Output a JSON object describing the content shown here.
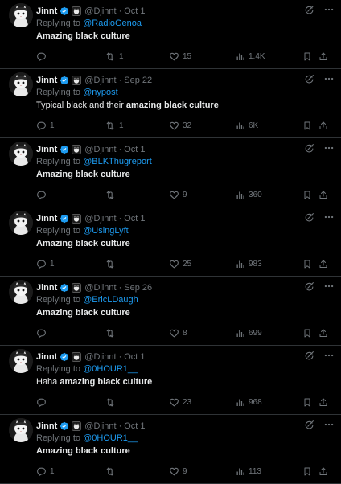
{
  "colors": {
    "background": "#000000",
    "text": "#e7e9ea",
    "muted": "#71767b",
    "link": "#1d9bf0",
    "divider": "#2f3336",
    "verified": "#1d9bf0"
  },
  "icons": {
    "verified": "verified-badge-icon",
    "affiliate": "affiliate-badge-icon",
    "grok": "grok-icon",
    "more": "more-icon",
    "reply": "reply-icon",
    "retweet": "retweet-icon",
    "like": "like-icon",
    "views": "views-icon",
    "bookmark": "bookmark-icon",
    "share": "share-icon"
  },
  "tweets": [
    {
      "name": "Jinnt",
      "handle": "@Djinnt",
      "separator": "·",
      "time": "Oct 1",
      "replying_prefix": "Replying to ",
      "replying_to": "@RadioGenoa",
      "text_plain": "",
      "text_bold": "Amazing black culture",
      "replies": "",
      "retweets": "1",
      "likes": "15",
      "views": "1.4K"
    },
    {
      "name": "Jinnt",
      "handle": "@Djinnt",
      "separator": "·",
      "time": "Sep 22",
      "replying_prefix": "Replying to ",
      "replying_to": "@nypost",
      "text_plain": "Typical black and their ",
      "text_bold": "amazing black culture",
      "replies": "1",
      "retweets": "1",
      "likes": "32",
      "views": "6K"
    },
    {
      "name": "Jinnt",
      "handle": "@Djinnt",
      "separator": "·",
      "time": "Oct 1",
      "replying_prefix": "Replying to ",
      "replying_to": "@BLKThugreport",
      "text_plain": "",
      "text_bold": "Amazing black culture",
      "replies": "",
      "retweets": "",
      "likes": "9",
      "views": "360"
    },
    {
      "name": "Jinnt",
      "handle": "@Djinnt",
      "separator": "·",
      "time": "Oct 1",
      "replying_prefix": "Replying to ",
      "replying_to": "@UsingLyft",
      "text_plain": "",
      "text_bold": "Amazing black culture",
      "replies": "1",
      "retweets": "",
      "likes": "25",
      "views": "983"
    },
    {
      "name": "Jinnt",
      "handle": "@Djinnt",
      "separator": "·",
      "time": "Sep 26",
      "replying_prefix": "Replying to ",
      "replying_to": "@EricLDaugh",
      "text_plain": "",
      "text_bold": "Amazing black culture",
      "replies": "",
      "retweets": "",
      "likes": "8",
      "views": "699"
    },
    {
      "name": "Jinnt",
      "handle": "@Djinnt",
      "separator": "·",
      "time": "Oct 1",
      "replying_prefix": "Replying to ",
      "replying_to": "@0HOUR1__",
      "text_plain": "Haha ",
      "text_bold": "amazing black culture",
      "replies": "",
      "retweets": "",
      "likes": "23",
      "views": "968"
    },
    {
      "name": "Jinnt",
      "handle": "@Djinnt",
      "separator": "·",
      "time": "Oct 1",
      "replying_prefix": "Replying to ",
      "replying_to": "@0HOUR1__",
      "text_plain": "",
      "text_bold": "Amazing black culture",
      "replies": "1",
      "retweets": "",
      "likes": "9",
      "views": "113"
    }
  ]
}
